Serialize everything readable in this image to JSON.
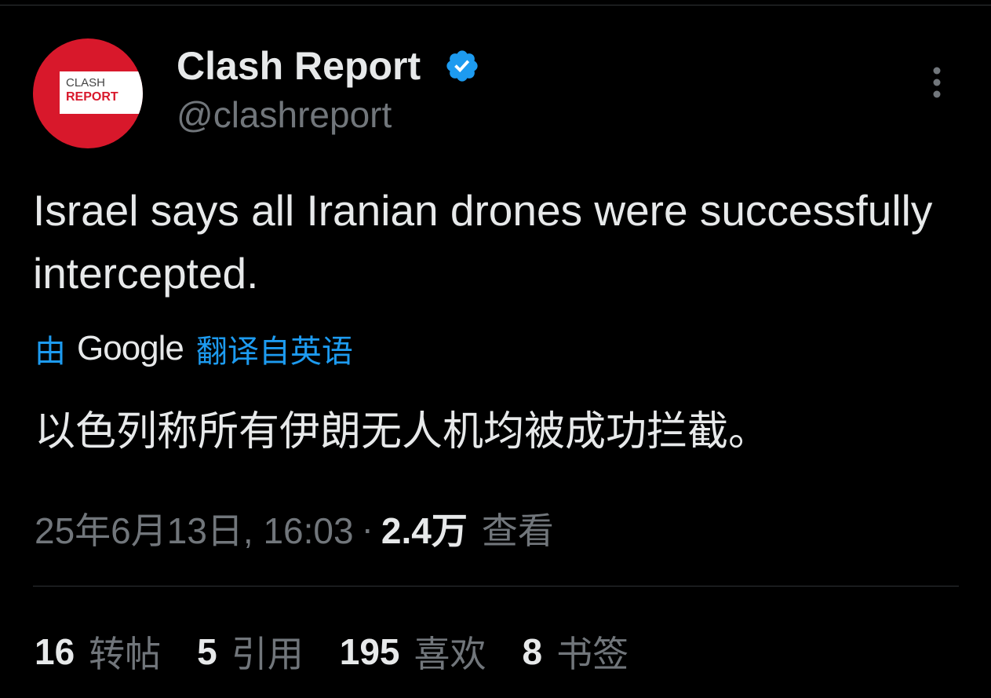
{
  "colors": {
    "background": "#000000",
    "primary_text": "#e7e9ea",
    "secondary_text": "#71767b",
    "link_blue": "#1d9bf0",
    "verified_blue": "#1d9bf0",
    "avatar_red": "#d8182b",
    "divider": "#2f3336"
  },
  "author": {
    "display_name": "Clash Report",
    "handle": "@clashreport",
    "verified_icon": "verified-badge-icon",
    "avatar": {
      "logo_top": "CLASH",
      "logo_bottom": "REPORT"
    }
  },
  "menu": {
    "icon": "more-vertical-icon"
  },
  "tweet": {
    "text": "Israel says all Iranian drones were successfully intercepted."
  },
  "translation": {
    "by_label": "由",
    "provider": "Google",
    "from_label": "翻译自英语",
    "text": "以色列称所有伊朗无人机均被成功拦截。"
  },
  "meta": {
    "date": "25年6月13日, 16:03",
    "separator": "·",
    "views_count": "2.4万",
    "views_label": "查看"
  },
  "stats": [
    {
      "count": "16",
      "label": "转帖"
    },
    {
      "count": "5",
      "label": "引用"
    },
    {
      "count": "195",
      "label": "喜欢"
    },
    {
      "count": "8",
      "label": "书签"
    }
  ]
}
